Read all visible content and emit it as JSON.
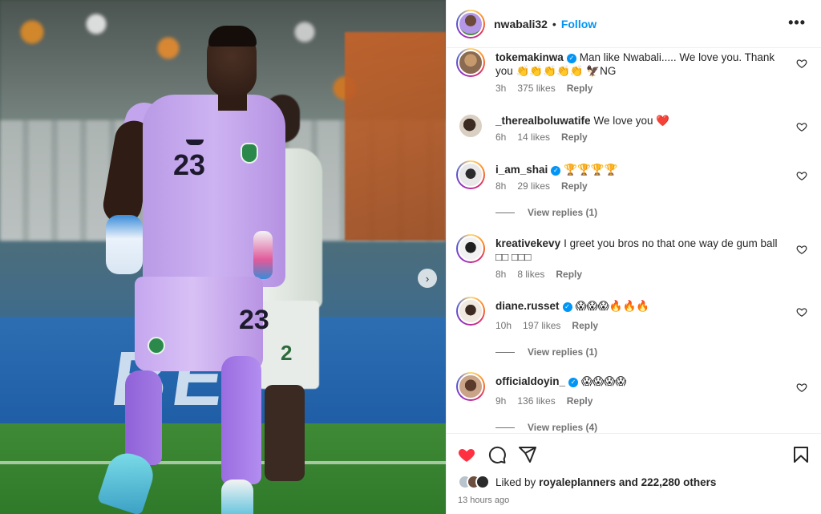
{
  "post": {
    "username": "nwabali32",
    "separator": "•",
    "follow_label": "Follow",
    "more_label": "•••",
    "next_label": "›",
    "photo": {
      "jersey_number": "23",
      "shorts_number": "23",
      "background_player_number": "2",
      "board_text": "BET"
    }
  },
  "comments": [
    {
      "user": "tokemakinwa",
      "verified": true,
      "text": "Man like Nwabali..... We love you. Thank you 👏👏👏👏👏 🦅NG",
      "time": "3h",
      "likes": "375 likes",
      "reply": "Reply"
    },
    {
      "user": "_therealboluwatife",
      "verified": false,
      "text": "We love you ❤️",
      "time": "6h",
      "likes": "14 likes",
      "reply": "Reply"
    },
    {
      "user": "i_am_shai",
      "verified": true,
      "text": "🏆🏆🏆🏆",
      "time": "8h",
      "likes": "29 likes",
      "reply": "Reply",
      "view_replies": "View replies (1)"
    },
    {
      "user": "kreativekevy",
      "verified": false,
      "text": "I greet you bros no that one way de gum ball □□ □□□",
      "time": "8h",
      "likes": "8 likes",
      "reply": "Reply"
    },
    {
      "user": "diane.russet",
      "verified": true,
      "text": "😱😱😱🔥🔥🔥",
      "time": "10h",
      "likes": "197 likes",
      "reply": "Reply",
      "view_replies": "View replies (1)"
    },
    {
      "user": "officialdoyin_",
      "verified": true,
      "text": "😱😱😱😱",
      "time": "9h",
      "likes": "136 likes",
      "reply": "Reply",
      "view_replies": "View replies (4)"
    }
  ],
  "footer": {
    "liked_prefix": "Liked by",
    "liked_user": "royaleplanners",
    "liked_suffix": "and 222,280 others",
    "time_ago": "13 hours ago"
  },
  "colors": {
    "accent": "#0095f6",
    "like_red": "#ff3040",
    "text": "#262626",
    "muted": "#737373"
  },
  "icons": [
    "heart-icon",
    "comment-icon",
    "share-icon",
    "bookmark-icon",
    "more-icon",
    "verified-icon",
    "chevron-right-icon"
  ]
}
